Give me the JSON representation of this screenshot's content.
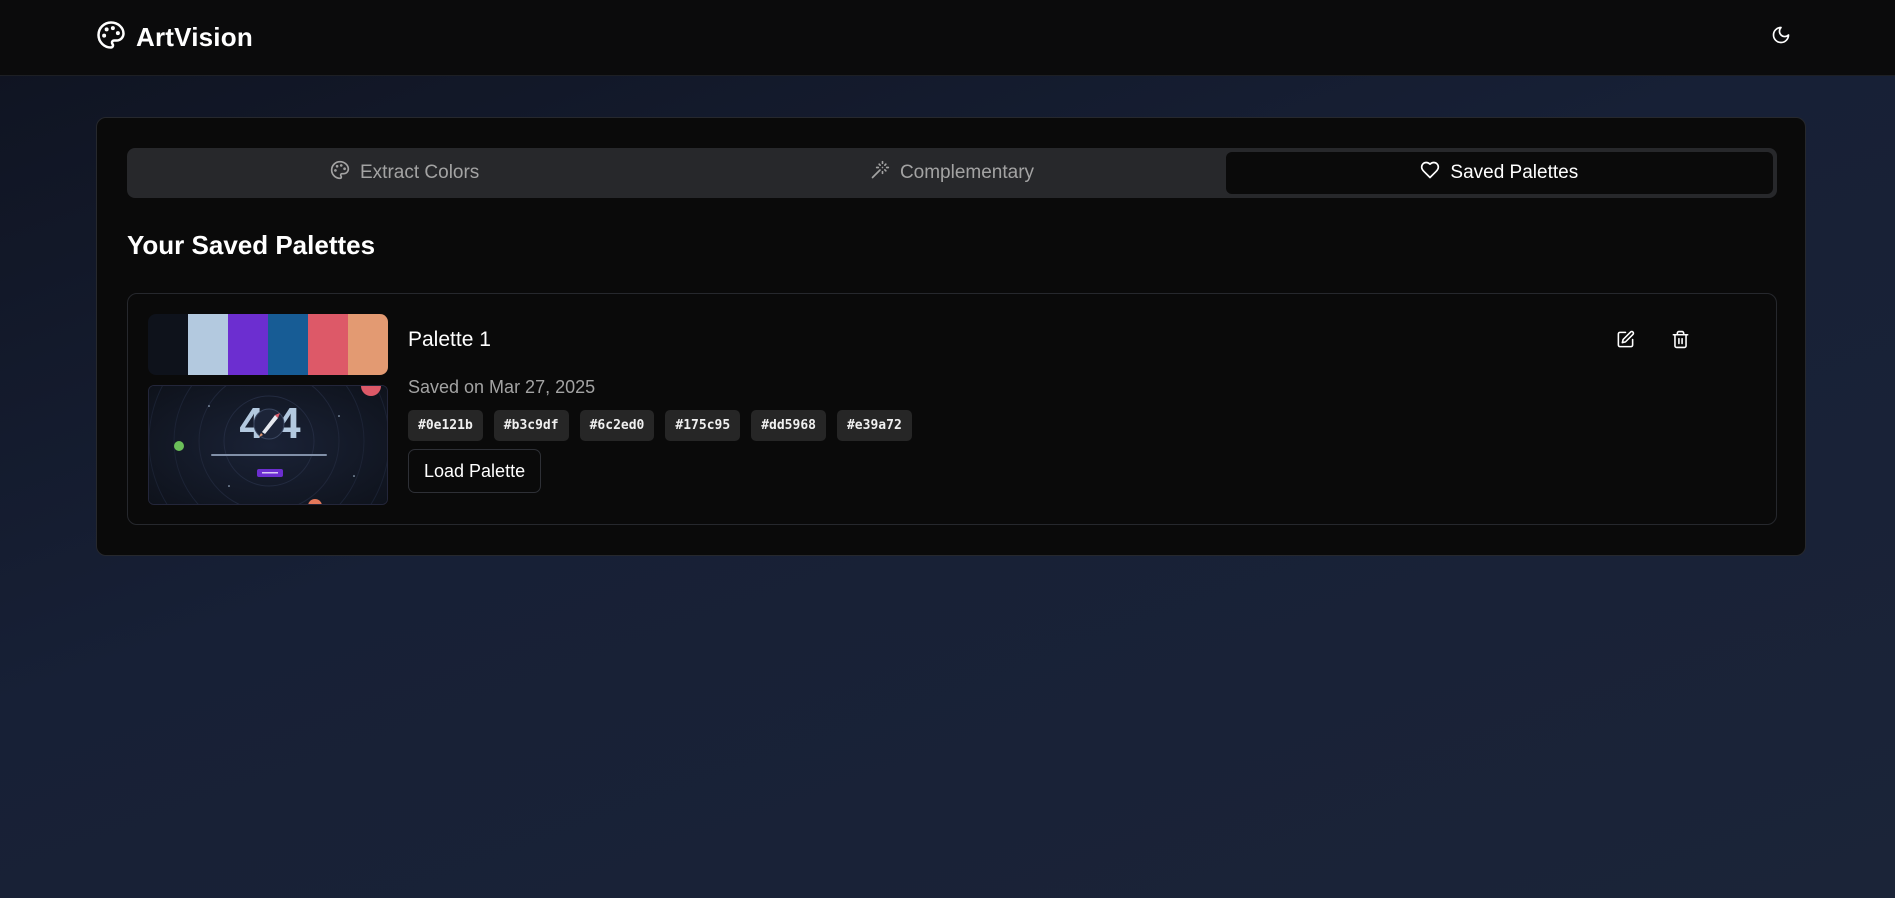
{
  "app": {
    "name": "ArtVision",
    "logo_icon": "palette-icon",
    "theme_toggle_icon": "moon-icon"
  },
  "tabs": [
    {
      "label": "Extract Colors",
      "icon": "palette-icon",
      "active": false
    },
    {
      "label": "Complementary",
      "icon": "wand-icon",
      "active": false
    },
    {
      "label": "Saved Palettes",
      "icon": "heart-icon",
      "active": true
    }
  ],
  "saved": {
    "title": "Your Saved Palettes",
    "palettes": [
      {
        "name": "Palette 1",
        "saved_text": "Saved on Mar 27, 2025",
        "colors": [
          "#0e121b",
          "#b3c9df",
          "#6c2ed0",
          "#175c95",
          "#dd5968",
          "#e39a72"
        ],
        "load_label": "Load Palette",
        "edit_icon": "edit-icon",
        "delete_icon": "trash-icon",
        "thumbnail": {
          "headline": "404",
          "subtitle": "page not found",
          "button": "Go home"
        }
      }
    ]
  }
}
